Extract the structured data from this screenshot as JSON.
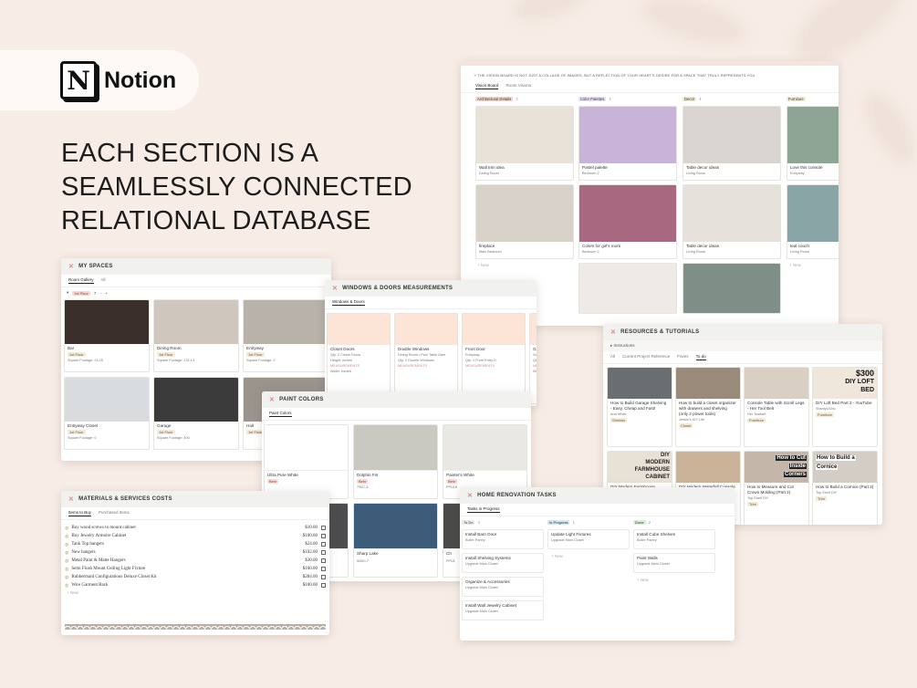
{
  "logo": {
    "text": "Notion",
    "glyph": "N"
  },
  "headline": [
    "EACH SECTION IS A",
    "SEAMLESSLY CONNECTED",
    "RELATIONAL DATABASE"
  ],
  "vision": {
    "quote": "THE VISION BOARD IS NOT JUST A COLLAGE OF IMAGES, BUT A REFLECTION OF YOUR HEART'S DESIRE FOR A SPACE THAT TRULY REPRESENTS YOU",
    "tabs": [
      "Vision Board",
      "Room Visions"
    ],
    "columns": [
      {
        "label": "Architectural Details",
        "count": "2",
        "color": "#f1d9cf"
      },
      {
        "label": "Color Palettes",
        "count": "4",
        "color": "#e9e0f5"
      },
      {
        "label": "Decor",
        "count": "4",
        "color": "#f3ebd9"
      },
      {
        "label": "Furniture",
        "count": "",
        "color": "#f3ebd9"
      }
    ],
    "cards": [
      {
        "title": "Wall trim idea",
        "sub": "Dining Room"
      },
      {
        "title": "Pastel palette",
        "sub": "Bedroom 2"
      },
      {
        "title": "Table decor ideas",
        "sub": "Living Room"
      },
      {
        "title": "Love this console",
        "sub": "Entryway"
      },
      {
        "title": "fireplace",
        "sub": "Main Bedroom"
      },
      {
        "title": "Colors for girl's room",
        "sub": "Bedroom 2"
      },
      {
        "title": "Table decor ideas",
        "sub": "Living Room"
      },
      {
        "title": "teal couch",
        "sub": "Living Room"
      }
    ],
    "new_label": "+ New"
  },
  "spaces": {
    "title": "MY SPACES",
    "tabs": [
      "Room Gallery",
      "All"
    ],
    "floor": "1st Floor",
    "floor_count": "7",
    "cards": [
      {
        "title": "Bar",
        "tag": "1st Floor",
        "sub": "Square Footage: 24.25"
      },
      {
        "title": "Dining Room",
        "tag": "1st Floor",
        "sub": "Square Footage: 132.13"
      },
      {
        "title": "Entryway",
        "tag": "1st Floor",
        "sub": "Square Footage: 0"
      },
      {
        "title": "Entryway Closet",
        "tag": "1st Floor",
        "sub": "Square Footage: 0"
      },
      {
        "title": "Garage",
        "tag": "1st Floor",
        "sub": "Square Footage: 400"
      },
      {
        "title": "Hall",
        "tag": "1st Floor",
        "sub": ""
      }
    ]
  },
  "windows": {
    "title": "WINDOWS & DOORS MEASUREMENTS",
    "tab": "Windows & Doors",
    "cards": [
      {
        "title": "Closet Doors",
        "sub": "Qty: 2 Closet Doors",
        "m1": "Height: inches",
        "m2": "Width: inches"
      },
      {
        "title": "Double Windows",
        "sub": "Dining Room • Pool Table Gam",
        "m1": "Qty: 2 Double Windows",
        "m2": ""
      },
      {
        "title": "Front Door",
        "sub": "Entryway",
        "m1": "Qty: 1 Front Entry D",
        "m2": ""
      },
      {
        "title": "Garage Access Door",
        "sub": "Garage",
        "m1": "Qty: 1 Garage Access Door",
        "m2": "Width: inches"
      }
    ],
    "measure_label": "MEASUREMENTS"
  },
  "paint": {
    "title": "PAINT COLORS",
    "tab": "Paint Colors",
    "swatches": [
      {
        "name": "Ultra Pure White",
        "tag": "Behr",
        "code": "",
        "color": "#ffffff"
      },
      {
        "name": "Dolphin Fin",
        "tag": "Behr",
        "code": "790C-3",
        "color": "#c9c8c1"
      },
      {
        "name": "Painter's White",
        "tag": "Behr",
        "code": "PPU18",
        "color": "#e9e8e2"
      },
      {
        "name": "",
        "tag": "",
        "code": "",
        "color": "#4d4d4f"
      },
      {
        "name": "Sharp Lake",
        "tag": "",
        "code": "M490-7",
        "color": "#3c5c79"
      },
      {
        "name": "Ch",
        "tag": "",
        "code": "PPU1",
        "color": "#4a4a48"
      }
    ]
  },
  "resources": {
    "title": "RESOURCES & TUTORIALS",
    "toggle": "Instructions",
    "tabs": [
      "All",
      "Current Project Reference",
      "Faves",
      "To do"
    ],
    "cards": [
      {
        "title": "How to Build Garage Shelving - Easy, Cheap and Fast!",
        "src": "Ana White",
        "tag": "Shelves",
        "img": "#6b6e70"
      },
      {
        "title": "How to build a closet organizer with drawers and shelving (only 2 power tools)",
        "src": "Jenkin's DIY Life",
        "tag": "Closet",
        "img": "#9a8a7a"
      },
      {
        "title": "Console Table with Scroll Legs - Her Tool Belt",
        "src": "Her Toolbelt",
        "tag": "Furniture",
        "img": "#d9cfc2"
      },
      {
        "title": "DIY Loft Bed Part 2 - YouTube",
        "src": "ShantyUChic",
        "tag": "Furniture",
        "img": "#efe7dc"
      },
      {
        "title": "DIY Modern Farmhouse Storage Cabinet",
        "src": "ShantyUChic",
        "tag": "Furniture",
        "img": "#e8e1d6"
      },
      {
        "title": "DIY Modern Waterfall Console Table",
        "src": "ShantyUChic",
        "tag": "Furniture",
        "img": "#cbb399"
      },
      {
        "title": "How to Measure and Cut Crown Molding (Part 2)",
        "src": "Top Shelf DIY",
        "tag": "Trim",
        "img": "#c4b6a8"
      },
      {
        "title": "How to Build a Cornice (Part 2)",
        "src": "Top Shelf DIY",
        "tag": "Trim",
        "img": "#d3cdc6"
      }
    ],
    "overlay": {
      "price": "$300",
      "loft1": "DIY LOFT",
      "loft2": "BED",
      "farm1": "DIY",
      "farm2": "MODERN",
      "farm3": "FARMHOUSE",
      "farm4": "CABINET",
      "crown1": "How to Cut",
      "crown2": "Inside",
      "crown3": "Corners",
      "cornice1": "How to Build a",
      "cornice2": "Cornice"
    }
  },
  "materials": {
    "title": "MATERIALS & SERVICES COSTS",
    "tabs": [
      "Items to Buy",
      "Purchased Items"
    ],
    "items": [
      {
        "name": "Buy wood screws to mount cabinet",
        "price": "$10.00"
      },
      {
        "name": "Buy Jewelry Armoire Cabinet",
        "price": "$100.00"
      },
      {
        "name": "Tank Top hangers",
        "price": "$24.00"
      },
      {
        "name": "New hangers",
        "price": "$102.00"
      },
      {
        "name": "Metal Paint & Matte Hangers",
        "price": "$30.00"
      },
      {
        "name": "Semi Flush Mount Ceiling Light Fixture",
        "price": "$160.00"
      },
      {
        "name": "Rubbermaid Configurations Deluxe Closet Kit",
        "price": "$284.00"
      },
      {
        "name": "Wire Garment Rack",
        "price": "$100.00"
      }
    ],
    "new_label": "+ New"
  },
  "tasks": {
    "title": "HOME RENOVATION TASKS",
    "tab": "Tasks in Progress",
    "columns": [
      {
        "label": "To Do",
        "count": "4",
        "color": "#ececea"
      },
      {
        "label": "In Progress",
        "count": "1",
        "color": "#d3e5ef"
      },
      {
        "label": "Done",
        "count": "2",
        "color": "#dbeddb"
      }
    ],
    "todo": [
      {
        "title": "Install Barn Door",
        "sub": "Boiler Pantry"
      },
      {
        "title": "Install Shelving Systems",
        "sub": "Upgrade Main Closet"
      },
      {
        "title": "Organize & Accessories",
        "sub": "Upgrade Main Closet"
      },
      {
        "title": "Install Wall Jewelry Cabinet",
        "sub": "Upgrade Main Closet"
      }
    ],
    "progress": [
      {
        "title": "Update Light Fixtures",
        "sub": "Upgrade Main Closet"
      }
    ],
    "done": [
      {
        "title": "Install Cube Shelves",
        "sub": "Boiler Pantry"
      },
      {
        "title": "Paint Walls",
        "sub": "Upgrade Main Closet"
      }
    ],
    "new_label": "+ New"
  }
}
